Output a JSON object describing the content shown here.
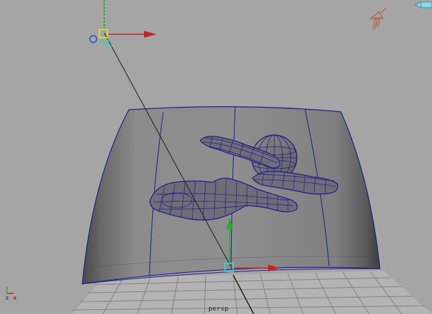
{
  "viewport": {
    "camera_label": "persp",
    "axis_indicator": {
      "z": "z",
      "x": "x"
    }
  },
  "colors": {
    "background": "#a5a5a5",
    "wireframe": "#1a1a8c",
    "manipulator_x": "#c82020",
    "manipulator_y": "#20b020",
    "manipulator_z": "#2050d0",
    "light_icon": "#b85a3a",
    "selection_yellow": "#e8e81a"
  },
  "icons": [
    "light-icon",
    "camera-icon",
    "move-manipulator-icon",
    "axis-indicator-icon"
  ]
}
